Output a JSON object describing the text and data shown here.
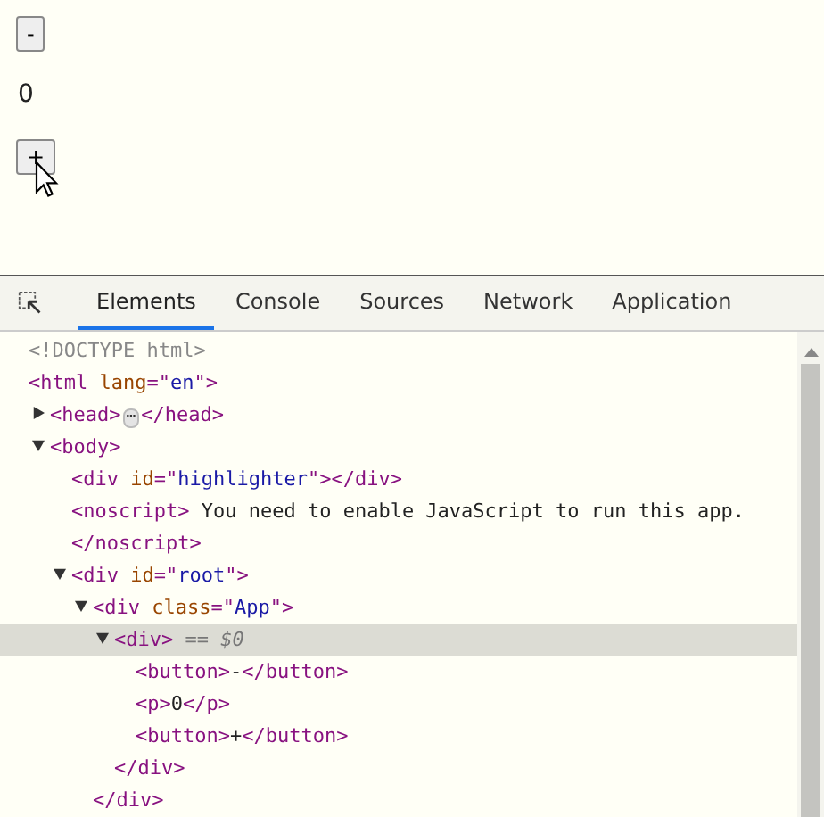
{
  "page": {
    "minus_button": "-",
    "counter": "0",
    "plus_button": "+"
  },
  "devtools": {
    "tabs": [
      {
        "label": "Elements",
        "selected": true
      },
      {
        "label": "Console",
        "selected": false
      },
      {
        "label": "Sources",
        "selected": false
      },
      {
        "label": "Network",
        "selected": false
      },
      {
        "label": "Application",
        "selected": false
      }
    ],
    "tree": [
      {
        "open": [
          {
            "kind": "doctype",
            "text": "<!DOCTYPE html>"
          }
        ]
      },
      {
        "open": [
          {
            "kind": "tag",
            "text": "<html"
          },
          {
            "kind": "attr",
            "text": " lang"
          },
          {
            "kind": "tag",
            "text": "=\""
          },
          {
            "kind": "value",
            "text": "en"
          },
          {
            "kind": "tag",
            "text": "\">"
          }
        ],
        "children": [
          {
            "open": [
              {
                "kind": "tag",
                "text": "<head>"
              },
              {
                "kind": "ellipsis",
                "text": "⋯"
              },
              {
                "kind": "tag",
                "text": "</head>"
              }
            ],
            "expanded": false
          },
          {
            "open": [
              {
                "kind": "tag",
                "text": "<body>"
              }
            ],
            "expanded": true,
            "children": [
              {
                "open": [
                  {
                    "kind": "tag",
                    "text": "<div"
                  },
                  {
                    "kind": "attr",
                    "text": " id"
                  },
                  {
                    "kind": "tag",
                    "text": "=\""
                  },
                  {
                    "kind": "value",
                    "text": "highlighter"
                  },
                  {
                    "kind": "tag",
                    "text": "\"></div>"
                  }
                ]
              },
              {
                "open": [
                  {
                    "kind": "tag",
                    "text": "<noscript>"
                  },
                  {
                    "kind": "text",
                    "text": " You need to enable JavaScript to run this app."
                  }
                ],
                "close": [
                  {
                    "kind": "tag",
                    "text": "</noscript>"
                  }
                ]
              },
              {
                "open": [
                  {
                    "kind": "tag",
                    "text": "<div"
                  },
                  {
                    "kind": "attr",
                    "text": " id"
                  },
                  {
                    "kind": "tag",
                    "text": "=\""
                  },
                  {
                    "kind": "value",
                    "text": "root"
                  },
                  {
                    "kind": "tag",
                    "text": "\">"
                  }
                ],
                "expanded": true,
                "children": [
                  {
                    "open": [
                      {
                        "kind": "tag",
                        "text": "<div"
                      },
                      {
                        "kind": "attr",
                        "text": " class"
                      },
                      {
                        "kind": "tag",
                        "text": "=\""
                      },
                      {
                        "kind": "value",
                        "text": "App"
                      },
                      {
                        "kind": "tag",
                        "text": "\">"
                      }
                    ],
                    "expanded": true,
                    "children": [
                      {
                        "open": [
                          {
                            "kind": "tag",
                            "text": "<div>"
                          },
                          {
                            "kind": "ref",
                            "text": " == $0"
                          }
                        ],
                        "expanded": true,
                        "selected": true,
                        "children": [
                          {
                            "open": [
                              {
                                "kind": "tag",
                                "text": "<button>"
                              },
                              {
                                "kind": "text",
                                "text": "-"
                              },
                              {
                                "kind": "tag",
                                "text": "</button>"
                              }
                            ]
                          },
                          {
                            "open": [
                              {
                                "kind": "tag",
                                "text": "<p>"
                              },
                              {
                                "kind": "text",
                                "text": "0"
                              },
                              {
                                "kind": "tag",
                                "text": "</p>"
                              }
                            ]
                          },
                          {
                            "open": [
                              {
                                "kind": "tag",
                                "text": "<button>"
                              },
                              {
                                "kind": "text",
                                "text": "+"
                              },
                              {
                                "kind": "tag",
                                "text": "</button>"
                              }
                            ]
                          }
                        ],
                        "close": [
                          {
                            "kind": "tag",
                            "text": "</div>"
                          }
                        ]
                      }
                    ],
                    "close": [
                      {
                        "kind": "tag",
                        "text": "</div>"
                      }
                    ]
                  }
                ]
              }
            ]
          }
        ]
      }
    ]
  }
}
